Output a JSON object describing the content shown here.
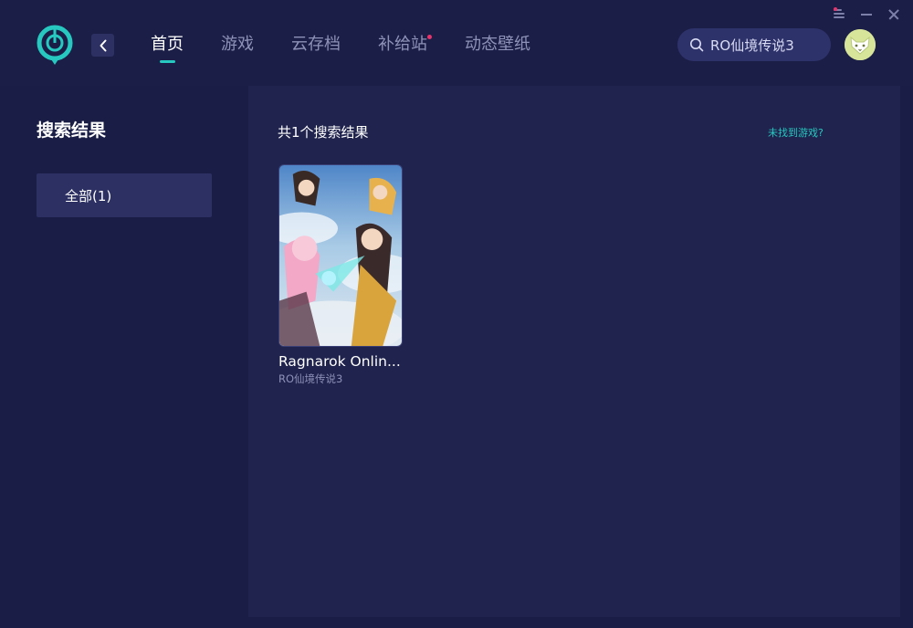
{
  "header": {
    "nav": [
      {
        "label": "首页",
        "active": true,
        "dot": false
      },
      {
        "label": "游戏",
        "active": false,
        "dot": false
      },
      {
        "label": "云存档",
        "active": false,
        "dot": false
      },
      {
        "label": "补给站",
        "active": false,
        "dot": true
      },
      {
        "label": "动态壁纸",
        "active": false,
        "dot": false
      }
    ],
    "search": {
      "value": "RO仙境传说3"
    }
  },
  "sidebar": {
    "title": "搜索结果",
    "items": [
      {
        "label": "全部(1)"
      }
    ]
  },
  "main": {
    "result_count": "共1个搜索结果",
    "not_found_link": "未找到游戏?",
    "games": [
      {
        "title": "Ragnarok Onlin...",
        "subtitle": "RO仙境传说3"
      }
    ]
  },
  "colors": {
    "background": "#1a1d45",
    "panel": "#1f234d",
    "accent": "#27c8c0",
    "notification": "#e8336b",
    "nav_inactive": "#8e91b8"
  },
  "icons": {
    "logo": "power-ring-logo-icon",
    "back": "chevron-left-icon",
    "search": "search-icon",
    "avatar": "fox-avatar-icon",
    "window": [
      "menu-icon",
      "minimize-icon",
      "close-icon"
    ]
  }
}
